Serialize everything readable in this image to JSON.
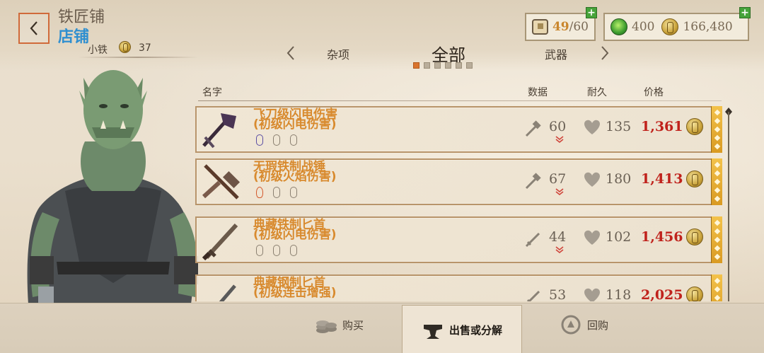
{
  "header": {
    "title": "铁匠铺",
    "subtitle": "店铺",
    "smith_name": "小铁",
    "smith_level": "37"
  },
  "stats": {
    "capacity_current": "49",
    "capacity_sep": " / ",
    "capacity_max": "60",
    "gems": "400",
    "gold": "166,480"
  },
  "tabs": {
    "prev_label": "杂项",
    "active_label": "全部",
    "next_label": "武器",
    "page_count": 6,
    "active_index": 0
  },
  "list_headers": {
    "name": "名字",
    "data": "数据",
    "durability": "耐久",
    "price": "价格"
  },
  "items": [
    {
      "name_line1": "飞刀级闪电伤害",
      "name_line2": "(初级闪电伤害)",
      "stat_icon": "hammer-icon",
      "stat": "60",
      "durability": "135",
      "price": "1,361",
      "enchants": [
        "shock",
        "empty",
        "empty"
      ]
    },
    {
      "name_line1": "无瑕铁制战锤",
      "name_line2": "(初级火焰伤害)",
      "stat_icon": "hammer-icon",
      "stat": "67",
      "durability": "180",
      "price": "1,413",
      "enchants": [
        "fire",
        "empty",
        "empty"
      ]
    },
    {
      "name_line1": "典藏铁制匕首",
      "name_line2": "(初级闪电伤害)",
      "stat_icon": "dagger-icon",
      "stat": "44",
      "durability": "102",
      "price": "1,456",
      "enchants": [
        "empty",
        "empty",
        "empty"
      ]
    },
    {
      "name_line1": "典藏钢制匕首",
      "name_line2": "(初级连击增强)",
      "stat_icon": "dagger-icon",
      "stat": "53",
      "durability": "118",
      "price": "2,025",
      "enchants": [
        "empty",
        "empty",
        "empty"
      ]
    }
  ],
  "bottom_tabs": {
    "buy": "购买",
    "sell": "出售或分解",
    "buyback": "回购"
  },
  "colors": {
    "accent_orange": "#d88a2e",
    "price_red": "#c0221c",
    "subtitle_blue": "#2f8fd0",
    "plus_green": "#46a33a"
  }
}
